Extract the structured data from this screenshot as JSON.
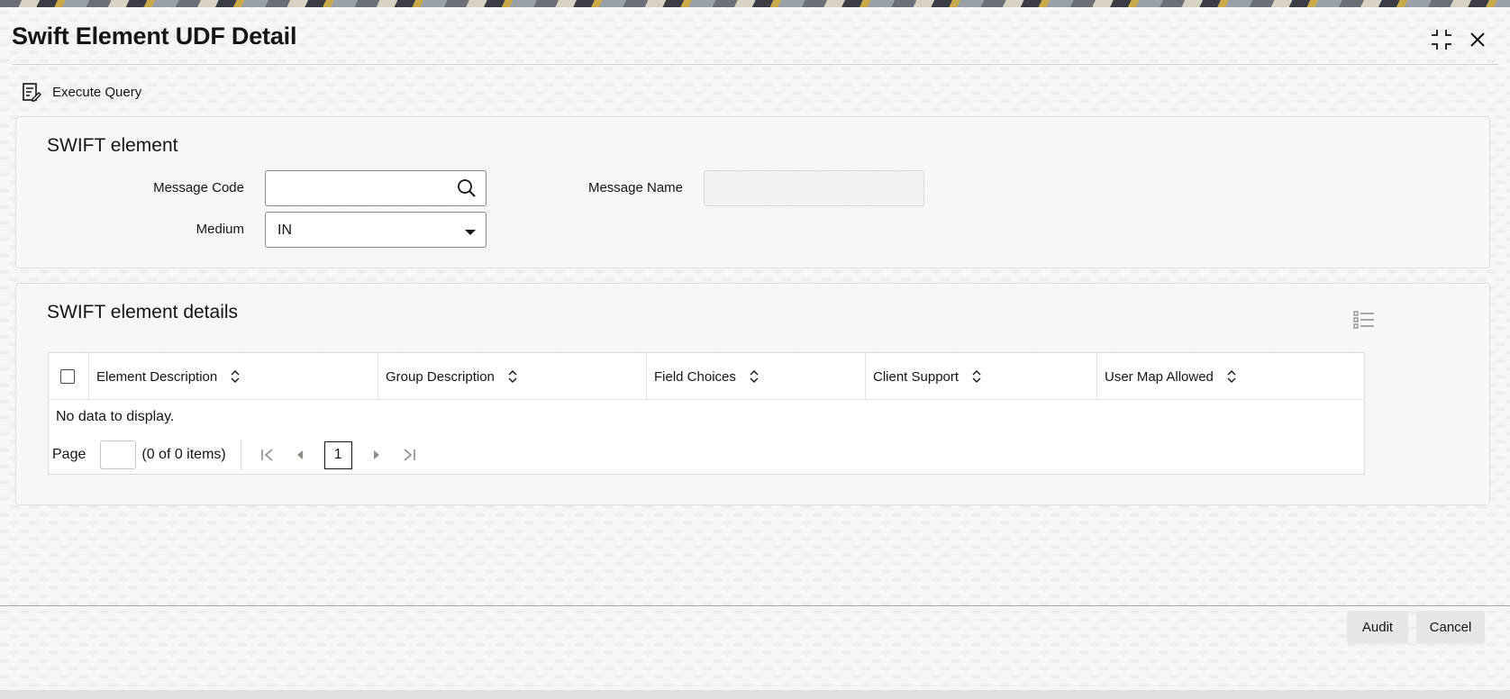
{
  "window": {
    "title": "Swift Element UDF Detail",
    "maximize_icon": "maximize-icon",
    "close_icon": "close-icon"
  },
  "toolbar": {
    "execute_query_label": "Execute Query",
    "execute_query_icon": "execute-query-icon"
  },
  "swift_element": {
    "section_title": "SWIFT element",
    "message_code_label": "Message Code",
    "message_code_value": "",
    "message_name_label": "Message Name",
    "message_name_value": "",
    "medium_label": "Medium",
    "medium_value": "IN"
  },
  "details": {
    "section_title": "SWIFT element details",
    "columns": [
      "Element Description",
      "Group Description",
      "Field Choices",
      "Client Support",
      "User Map Allowed"
    ],
    "empty_message": "No data to display.",
    "pager": {
      "page_label": "Page",
      "page_input": "",
      "items_text": "(0 of 0 items)",
      "current_page": "1"
    }
  },
  "footer": {
    "audit_label": "Audit",
    "cancel_label": "Cancel"
  },
  "colors": {
    "text": "#161513",
    "background": "#f7f6f4",
    "panel_border": "#e2dfdb",
    "button_bg": "#e9e7e4"
  }
}
